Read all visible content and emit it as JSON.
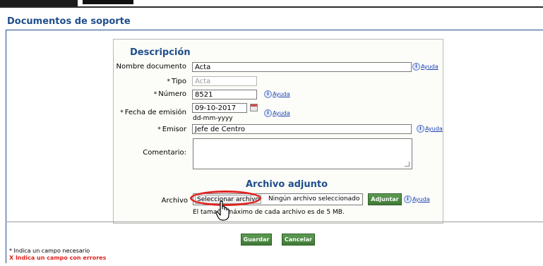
{
  "page": {
    "title": "Documentos de soporte"
  },
  "form": {
    "section_description": "Descripción",
    "section_attachment": "Archivo adjunto",
    "required_mark": "*",
    "help_label": "Ayuda",
    "fields": {
      "nombre": {
        "label": "Nombre documento",
        "value": "Acta"
      },
      "tipo": {
        "label": "Tipo",
        "value": "Acta"
      },
      "numero": {
        "label": "Número",
        "value": "8521"
      },
      "fecha": {
        "label": "Fecha de emisión",
        "value": "09-10-2017",
        "hint": "dd-mm-yyyy"
      },
      "emisor": {
        "label": "Emisor",
        "value": "Jefe de Centro"
      },
      "comentario": {
        "label": "Comentario:",
        "value": ""
      }
    },
    "archivo": {
      "label": "Archivo",
      "select_button": "Seleccionar archivo",
      "status": "Ningún archivo seleccionado",
      "attach_button": "Adjuntar",
      "note": "El tamaño máximo de cada archivo es de 5 MB."
    }
  },
  "actions": {
    "save": "Guardar",
    "cancel": "Cancelar"
  },
  "legend": {
    "required": "* Indica un campo necesario",
    "errors": "X Indica un campo con errores"
  },
  "colors": {
    "title": "#1f4e8c",
    "highlight_circle": "#e0231f",
    "button_green": "#4a8a40"
  }
}
